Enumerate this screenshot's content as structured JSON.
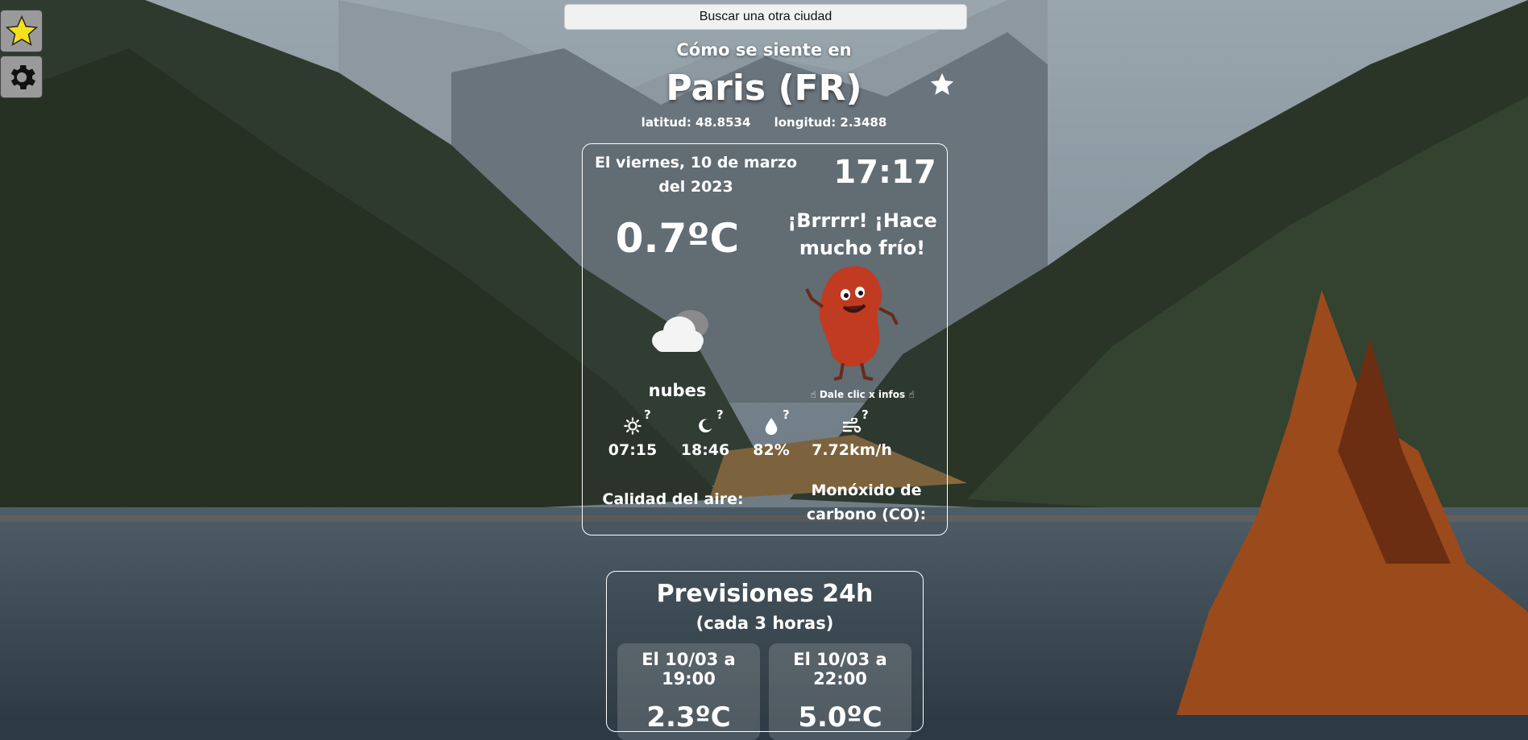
{
  "search": {
    "placeholder": "Buscar una otra ciudad"
  },
  "header": {
    "subtitle": "Cómo se siente en",
    "city": "Paris (FR)",
    "latitude": "latitud: 48.8534",
    "longitude": "longitud: 2.3488"
  },
  "current": {
    "date": "El viernes, 10 de marzo del 2023",
    "time": "17:17",
    "temperature": "0.7ºC",
    "message": "¡Brrrrr! ¡Hace mucho frío!",
    "description": "nubes",
    "hint": "☝ Dale clic x infos ☝",
    "sunrise": "07:15",
    "sunset": "18:46",
    "humidity": "82%",
    "wind": "7.72km/h",
    "air_quality_label": "Calidad del aire:",
    "co_label": "Monóxido de carbono (CO):",
    "help_mark": "?"
  },
  "forecast": {
    "title": "Previsiones 24h",
    "subtitle": "(cada 3 horas)",
    "items": [
      {
        "when": "El 10/03 a 19:00",
        "temp": "2.3ºC"
      },
      {
        "when": "El 10/03 a 22:00",
        "temp": "5.0ºC"
      }
    ]
  },
  "colors": {
    "favorite_star": "#f5e11a",
    "card_border": "#ffffff",
    "button_bg": "#9a9a9a"
  },
  "icons": {
    "favorites": "star-icon",
    "settings": "gear-icon",
    "add_favorite": "star-icon",
    "weather": "cloud-icon",
    "sunrise": "sun-icon",
    "sunset": "moon-icon",
    "humidity": "drop-icon",
    "wind": "wind-icon"
  }
}
